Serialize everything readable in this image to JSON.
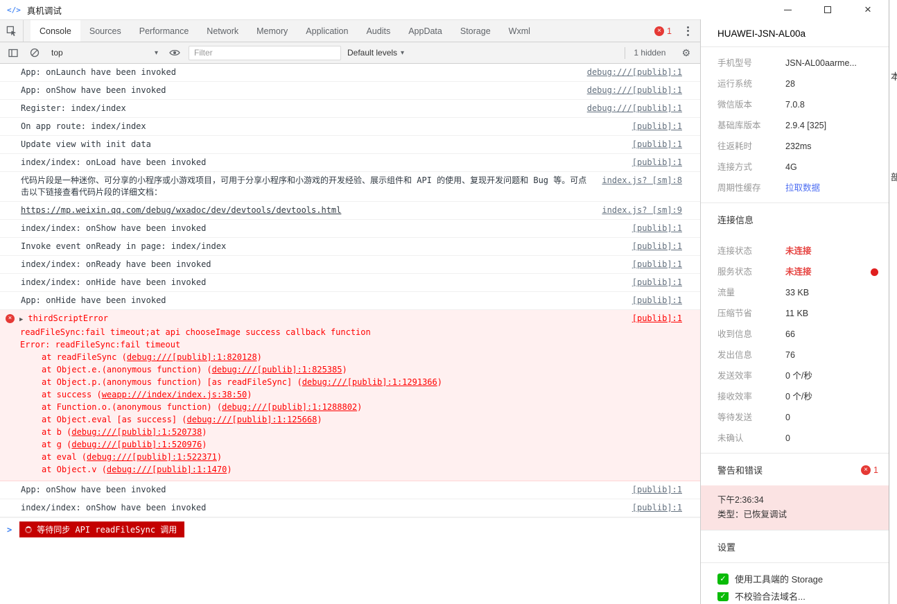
{
  "colors": {
    "badge_red": "#e53935",
    "error_red": "#ff0000",
    "error_bg": "#fff0f0",
    "status_red": "#e64340",
    "link_blue": "#4e6ef2",
    "wechat_green": "#09bb07",
    "alert_bg": "#fbe3e3",
    "sync_badge_red": "#c40000",
    "prompt_blue": "#367cf1"
  },
  "window": {
    "title": "真机调试"
  },
  "devtools": {
    "tabs": [
      {
        "label": "Console",
        "selected": true
      },
      {
        "label": "Sources"
      },
      {
        "label": "Performance"
      },
      {
        "label": "Network"
      },
      {
        "label": "Memory"
      },
      {
        "label": "Application"
      },
      {
        "label": "Audits"
      },
      {
        "label": "AppData"
      },
      {
        "label": "Storage"
      },
      {
        "label": "Wxml"
      }
    ],
    "error_count": "1"
  },
  "toolbar": {
    "context": "top",
    "filter_placeholder": "Filter",
    "levels_label": "Default levels",
    "hidden_label": "1 hidden"
  },
  "console": {
    "rows_top": [
      {
        "text": "App: onLaunch have been invoked",
        "source": "debug:///[publib]:1"
      },
      {
        "text": "App: onShow have been invoked",
        "source": "debug:///[publib]:1"
      },
      {
        "text": "Register: index/index",
        "source": "debug:///[publib]:1"
      },
      {
        "text": "On app route: index/index",
        "source": "[publib]:1"
      },
      {
        "text": "Update view with init data",
        "source": "[publib]:1"
      },
      {
        "text": "index/index: onLoad have been invoked",
        "source": "[publib]:1"
      },
      {
        "text": "代码片段是一种迷你、可分享的小程序或小游戏项目，可用于分享小程序和小游戏的开发经验、展示组件和 API 的使用、复现开发问题和 Bug 等。可点击以下链接查看代码片段的详细文档：",
        "source": "index.js? [sm]:8"
      },
      {
        "text": "https://mp.weixin.qq.com/debug/wxadoc/dev/devtools/devtools.html",
        "source": "index.js? [sm]:9",
        "link": true
      },
      {
        "text": "index/index: onShow have been invoked",
        "source": "[publib]:1"
      },
      {
        "text": "Invoke event onReady in page: index/index",
        "source": "[publib]:1"
      },
      {
        "text": "index/index: onReady have been invoked",
        "source": "[publib]:1"
      },
      {
        "text": "index/index: onHide have been invoked",
        "source": "[publib]:1"
      },
      {
        "text": "App: onHide have been invoked",
        "source": "[publib]:1"
      }
    ],
    "error": {
      "title": "thirdScriptError",
      "source": "[publib]:1",
      "message": "readFileSync:fail timeout;at api chooseImage success callback function",
      "error_line": "Error: readFileSync:fail timeout",
      "stack": [
        {
          "pre": "at readFileSync (",
          "link": "debug:///[publib]:1:820128",
          "post": ")"
        },
        {
          "pre": "at Object.e.(anonymous function) (",
          "link": "debug:///[publib]:1:825385",
          "post": ")"
        },
        {
          "pre": "at Object.p.(anonymous function) [as readFileSync] (",
          "link": "debug:///[publib]:1:1291366",
          "post": ")"
        },
        {
          "pre": "at success (",
          "link": "weapp:///index/index.js:38:50",
          "post": ")"
        },
        {
          "pre": "at Function.o.(anonymous function) (",
          "link": "debug:///[publib]:1:1288802",
          "post": ")"
        },
        {
          "pre": "at Object.eval [as success] (",
          "link": "debug:///[publib]:1:125668",
          "post": ")"
        },
        {
          "pre": "at b (",
          "link": "debug:///[publib]:1:520738",
          "post": ")"
        },
        {
          "pre": "at g (",
          "link": "debug:///[publib]:1:520976",
          "post": ")"
        },
        {
          "pre": "at eval (",
          "link": "debug:///[publib]:1:522371",
          "post": ")"
        },
        {
          "pre": "at Object.v (",
          "link": "debug:///[publib]:1:1470",
          "post": ")"
        }
      ]
    },
    "rows_bottom": [
      {
        "text": "App: onShow have been invoked",
        "source": "[publib]:1"
      },
      {
        "text": "index/index: onShow have been invoked",
        "source": "[publib]:1"
      }
    ],
    "prompt_badge": "等待同步 API readFileSync 调用"
  },
  "device": {
    "title": "HUAWEI-JSN-AL00a",
    "info_rows": [
      {
        "label": "手机型号",
        "value": "JSN-AL00aarme..."
      },
      {
        "label": "运行系统",
        "value": "28"
      },
      {
        "label": "微信版本",
        "value": "7.0.8"
      },
      {
        "label": "基础库版本",
        "value": "2.9.4 [325]"
      },
      {
        "label": "往返耗时",
        "value": "232ms"
      },
      {
        "label": "连接方式",
        "value": "4G"
      },
      {
        "label": "周期性缓存",
        "value": "拉取数据",
        "link": true
      }
    ],
    "sections": {
      "connection": "连接信息",
      "warnings": "警告和错误",
      "settings": "设置"
    },
    "connection_rows": [
      {
        "label": "连接状态",
        "value": "未连接",
        "red": true
      },
      {
        "label": "服务状态",
        "value": "未连接",
        "red": true,
        "dot": true
      },
      {
        "label": "流量",
        "value": "33 KB"
      },
      {
        "label": "压缩节省",
        "value": "11 KB"
      },
      {
        "label": "收到信息",
        "value": "66"
      },
      {
        "label": "发出信息",
        "value": "76"
      },
      {
        "label": "发送效率",
        "value": "0 个/秒"
      },
      {
        "label": "接收效率",
        "value": "0 个/秒"
      },
      {
        "label": "等待发送",
        "value": "0"
      },
      {
        "label": "未确认",
        "value": "0"
      }
    ],
    "warning_count": "1",
    "alert": {
      "time": "下午2:36:34",
      "type": "类型：已恢复调试"
    },
    "checkboxes": [
      {
        "label": "使用工具端的 Storage",
        "checked": true
      },
      {
        "label": "不校验合法域名...",
        "checked": true,
        "partial": true
      }
    ]
  },
  "edge_fragments": [
    "本",
    "部"
  ]
}
